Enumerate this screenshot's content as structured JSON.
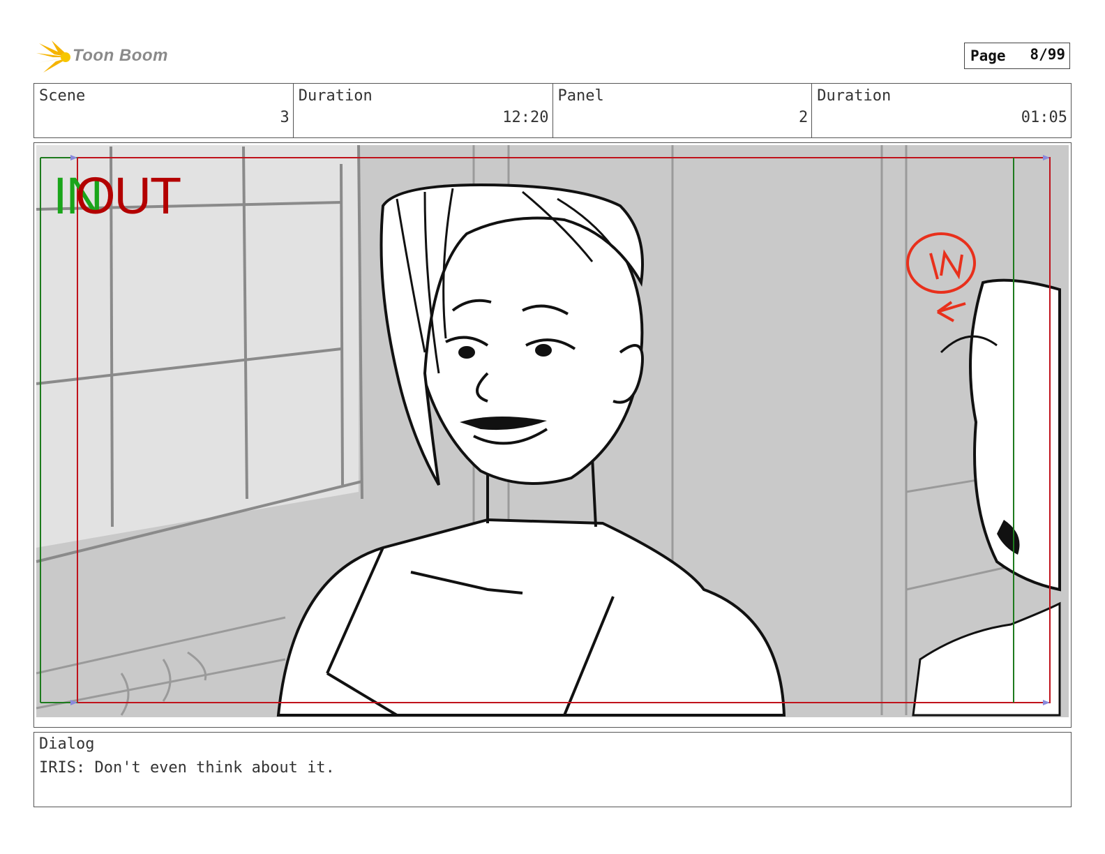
{
  "logo": {
    "text": "Toon Boom",
    "icon": "starburst-logo-icon"
  },
  "page": {
    "label": "Page",
    "value": "8/99"
  },
  "info": [
    {
      "label": "Scene",
      "value": "3"
    },
    {
      "label": "Duration",
      "value": "12:20"
    },
    {
      "label": "Panel",
      "value": "2"
    },
    {
      "label": "Duration",
      "value": "01:05"
    }
  ],
  "panel": {
    "in_label": "IN",
    "out_label": "OUT",
    "in_color": "#1aa51a",
    "out_color": "#b30000",
    "sketch_annotation": "IN"
  },
  "dialog": {
    "label": "Dialog",
    "text": "IRIS: Don't even think about it."
  }
}
